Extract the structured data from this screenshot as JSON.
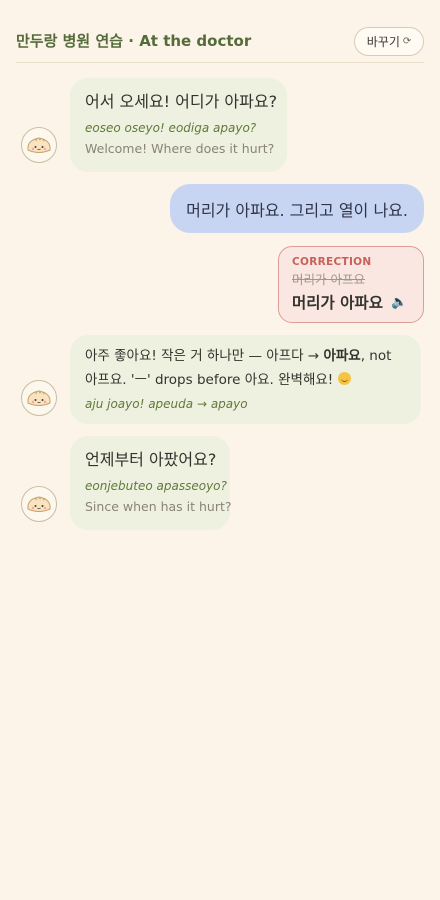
{
  "header": {
    "title": "만두랑 병원 연습 · At the doctor",
    "switch_label": "바꾸기",
    "switch_icon": "refresh-icon"
  },
  "messages": [
    {
      "role": "tutor",
      "korean": "어서 오세요! 어디가 아파요?",
      "romanization": "eoseo oseyo! eodiga apayo?",
      "english": "Welcome! Where does it hurt?"
    },
    {
      "role": "user",
      "text": "머리가 아파요. 그리고 열이 나요."
    },
    {
      "role": "correction",
      "label": "CORRECTION",
      "wrong": "머리가 아프요",
      "right": "머리가 아파요",
      "speaker_icon": "speaker-icon"
    },
    {
      "role": "tutor",
      "feedback_prefix": "아주 좋아요! 작은 거 하나만 — 아프다 → ",
      "feedback_bold": "아파요",
      "feedback_suffix": ", not 아프요. 'ㅡ' drops before 아요. 완벽해요!",
      "emoji": "smiling-face-icon",
      "romanization": "aju joayo! apeuda → apayo"
    },
    {
      "role": "tutor",
      "korean": "언제부터 아팠어요?",
      "romanization": "eonjebuteo apasseoyo?",
      "english": "Since when has it hurt?"
    }
  ],
  "colors": {
    "background": "#fcf4e8",
    "title": "#556b3a",
    "tutor_bubble": "#eef0e0",
    "user_bubble": "#c8d5f2",
    "correction_bg": "#fae7e2",
    "correction_border": "#df9d98",
    "romanization": "#5f7a38"
  }
}
